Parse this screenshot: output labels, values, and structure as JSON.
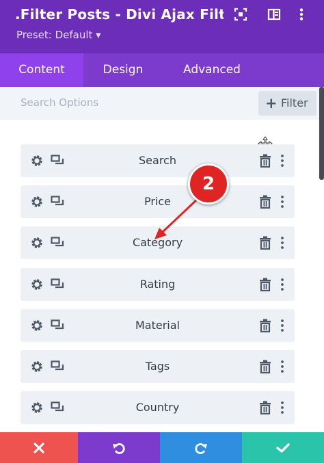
{
  "header": {
    "title": ".Filter Posts - Divi Ajax Filte...",
    "preset": "Preset: Default ▾",
    "icons": [
      "expand-icon",
      "split-view-icon",
      "more-vertical-icon"
    ]
  },
  "tabs": [
    {
      "label": "Content",
      "active": true
    },
    {
      "label": "Design",
      "active": false
    },
    {
      "label": "Advanced",
      "active": false
    }
  ],
  "search": {
    "placeholder": "Search Options"
  },
  "filter_button": {
    "icon": "+",
    "label": "Filter"
  },
  "filters": [
    {
      "label": "Search"
    },
    {
      "label": "Price"
    },
    {
      "label": "Category"
    },
    {
      "label": "Rating"
    },
    {
      "label": "Material"
    },
    {
      "label": "Tags"
    },
    {
      "label": "Country"
    }
  ],
  "annotation": {
    "number": "2",
    "color": "#e02424"
  },
  "footer": {
    "buttons": [
      {
        "icon": "close-icon",
        "color": "#ef5350"
      },
      {
        "icon": "undo-icon",
        "color": "#7d3bcd"
      },
      {
        "icon": "redo-icon",
        "color": "#2f8ee0"
      },
      {
        "icon": "check-icon",
        "color": "#29c4a9"
      }
    ]
  },
  "colors": {
    "header": "#6c2eb9",
    "tabs": "#7d3bcd",
    "active_tab": "#8f42ec",
    "row_bg": "#edf1f5"
  }
}
